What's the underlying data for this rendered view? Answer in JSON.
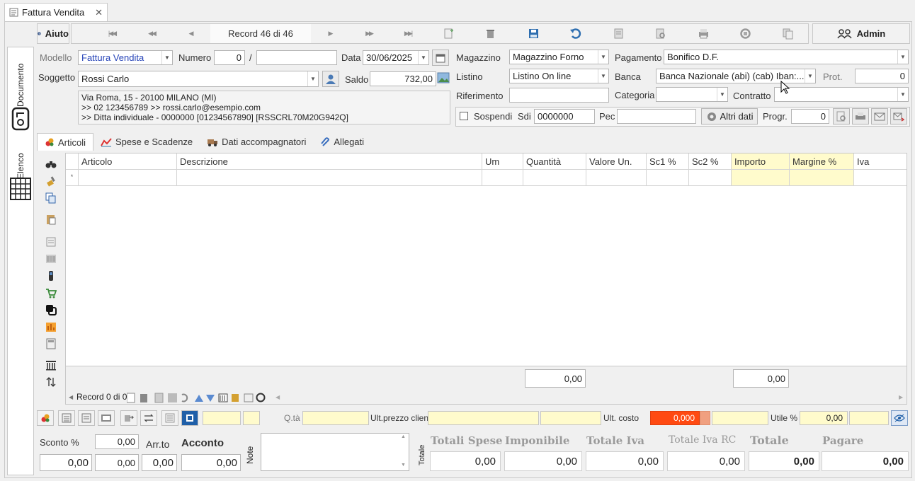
{
  "window_tab": {
    "title": "Fattura Vendita",
    "close": "✕"
  },
  "toolbar": {
    "help_label": "Aiuto",
    "record_label": "Record 46 di 46",
    "admin_label": "Admin"
  },
  "sidebar": {
    "documento": "Documento",
    "elenco": "Elenco"
  },
  "header": {
    "modello_label": "Modello",
    "modello_value": "Fattura Vendita",
    "numero_label": "Numero",
    "numero_value": "0",
    "numero_sep": "/",
    "numero_suffix": "",
    "data_label": "Data",
    "data_value": "30/06/2025",
    "soggetto_label": "Soggetto",
    "soggetto_value": "Rossi Carlo",
    "saldo_label": "Saldo",
    "saldo_value": "732,00",
    "address_lines": [
      "Via Roma, 15 - 20100 MILANO (MI)",
      ">> 02 123456789 >> rossi.carlo@esempio.com",
      ">> Ditta individuale - 0000000 [01234567890]  [RSSCRL70M20G942Q]"
    ],
    "magazzino_label": "Magazzino",
    "magazzino_value": "Magazzino Forno",
    "listino_label": "Listino",
    "listino_value": "Listino On line",
    "riferimento_label": "Riferimento",
    "riferimento_value": "",
    "sospendi_label": "Sospendi",
    "sdi_label": "Sdi",
    "sdi_value": "0000000",
    "pec_label": "Pec",
    "pec_value": "",
    "altri_dati_label": "Altri dati",
    "pagamento_label": "Pagamento",
    "pagamento_value": "Bonifico D.F.",
    "banca_label": "Banca",
    "banca_value": "Banca Nazionale (abi) (cab) Iban:...",
    "prot_label": "Prot.",
    "prot_value": "0",
    "categoria_label": "Categoria",
    "categoria_value": "",
    "contratto_label": "Contratto",
    "contratto_value": "",
    "progr_label": "Progr.",
    "progr_value": "0"
  },
  "tabs": [
    "Articoli",
    "Spese e Scadenze",
    "Dati accompagnatori",
    "Allegati"
  ],
  "grid": {
    "columns": [
      "Articolo",
      "Descrizione",
      "Um",
      "Quantità",
      "Valore Un.",
      "Sc1 %",
      "Sc2 %",
      "Importo",
      "Margine %",
      "Iva"
    ],
    "new_row_marker": "*",
    "footer_quantita": "0,00",
    "footer_importo": "0,00",
    "record_label": "Record 0 di 0"
  },
  "bottom_bar": {
    "qta_label": "Q.tà",
    "ult_prezzo_label": "Ult.prezzo clien.",
    "ult_costo_label": "Ult. costo",
    "ult_costo_value": "0,000",
    "utile_label": "Utile %",
    "utile_value": "0,00"
  },
  "totals": {
    "sconto_label": "Sconto %",
    "sconto_pct": "0,00",
    "sconto_value": "0,00",
    "sconto_value2": "0,00",
    "arr_label": "Arr.to",
    "arr_value": "0,00",
    "acconto_label": "Acconto",
    "acconto_value": "0,00",
    "note_label": "Note",
    "totale_vlabel": "Totale",
    "totali_spese_label": "Totali Spese",
    "totali_spese_value": "0,00",
    "imponibile_label": "Imponibile",
    "imponibile_value": "0,00",
    "totale_iva_label": "Totale Iva",
    "totale_iva_value": "0,00",
    "totale_iva_rc_label": "Totale Iva RC",
    "totale_iva_rc_value": "0,00",
    "totale_label": "Totale",
    "totale_value": "0,00",
    "pagare_label": "Pagare",
    "pagare_value": "0,00"
  },
  "colors": {
    "accent_orange": "#ff4a12",
    "yellow_field": "#fffbcc",
    "link_blue": "#2644b8"
  }
}
